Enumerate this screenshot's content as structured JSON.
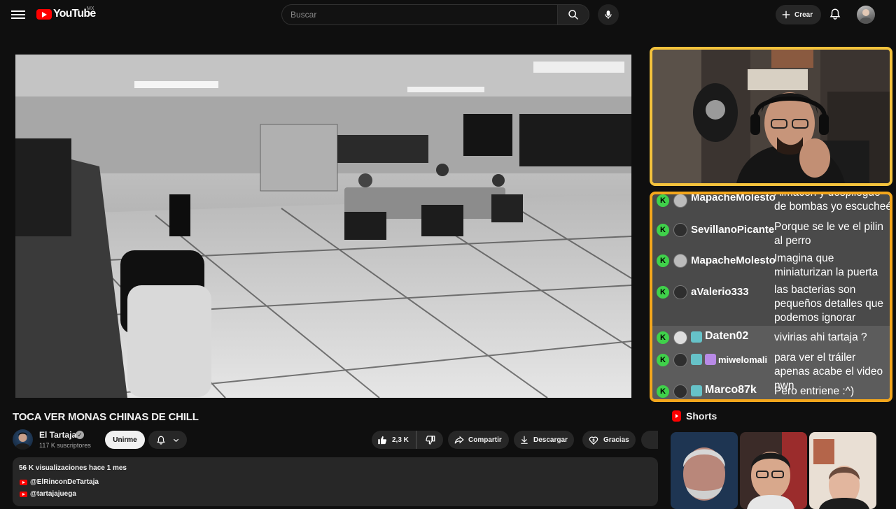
{
  "header": {
    "logo_text": "YouTube",
    "country_code": "MX",
    "search_placeholder": "Buscar",
    "create_label": "Crear"
  },
  "video": {
    "title": "TOCA VER MONAS CHINAS DE CHILL"
  },
  "channel": {
    "name": "El Tartaja",
    "subscribers": "117 K suscriptores",
    "join_label": "Unirme"
  },
  "actions": {
    "likes": "2,3 K",
    "share_label": "Compartir",
    "download_label": "Descargar",
    "thanks_label": "Gracias"
  },
  "description": {
    "stats": "56 K visualizaciones  hace 1 mes",
    "links": [
      "@ElRinconDeTartaja",
      "@tartajajuega"
    ]
  },
  "chat": {
    "messages": [
      {
        "user": "MapacheMolesto",
        "text": "Almacen y despliegue de bombas yo escucheé"
      },
      {
        "user": "SevillanoPicante",
        "text": "Porque se le ve el pilin al perro"
      },
      {
        "user": "MapacheMolesto",
        "text": "Imagina que miniaturizan la puerta"
      },
      {
        "user": "aValerio333",
        "text": "las bacterias son pequeños detalles que podemos ignorar"
      },
      {
        "user": "Daten02",
        "text": "vivirias ahi tartaja ?"
      },
      {
        "user": "miwelomali",
        "text": "para ver el tráiler apenas acabe el video nwn"
      },
      {
        "user": "Marco87k",
        "text": "Pero entriene :^)"
      }
    ]
  },
  "shorts": {
    "title": "Shorts"
  },
  "colors": {
    "cam_border": "#f3c23c",
    "chat_border": "#f3a61c",
    "brand_red": "#ff0000",
    "chat_badge": "#3fd14a"
  }
}
